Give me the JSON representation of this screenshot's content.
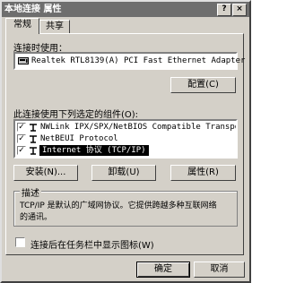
{
  "window": {
    "title": "本地连接 属性",
    "help": "?",
    "close": "×"
  },
  "tabs": [
    {
      "label": "常规"
    },
    {
      "label": "共享"
    }
  ],
  "connect_using": {
    "label": "连接时使用：",
    "adapter": "Realtek RTL8139(A) PCI Fast Ethernet Adapter",
    "configure_label": "配置(C)"
  },
  "components": {
    "label": "此连接使用下列选定的组件(O):",
    "items": [
      {
        "checked": true,
        "text": "NWLink IPX/SPX/NetBIOS Compatible Transport..."
      },
      {
        "checked": true,
        "text": "NetBEUI Protocol"
      },
      {
        "checked": true,
        "text": "Internet 协议 (TCP/IP)",
        "selected": true
      }
    ]
  },
  "actions": {
    "install": "安装(N)...",
    "uninstall": "卸载(U)",
    "properties": "属性(R)"
  },
  "description": {
    "title": "描述",
    "text_line1": "TCP/IP 是默认的广域网协议。它提供跨越多种互联网络",
    "text_line2": "的通讯。"
  },
  "taskbar_icon": {
    "checked": false,
    "label": "连接后在任务栏中显示图标(W)"
  },
  "footer": {
    "ok": "确定",
    "cancel": "取消"
  }
}
